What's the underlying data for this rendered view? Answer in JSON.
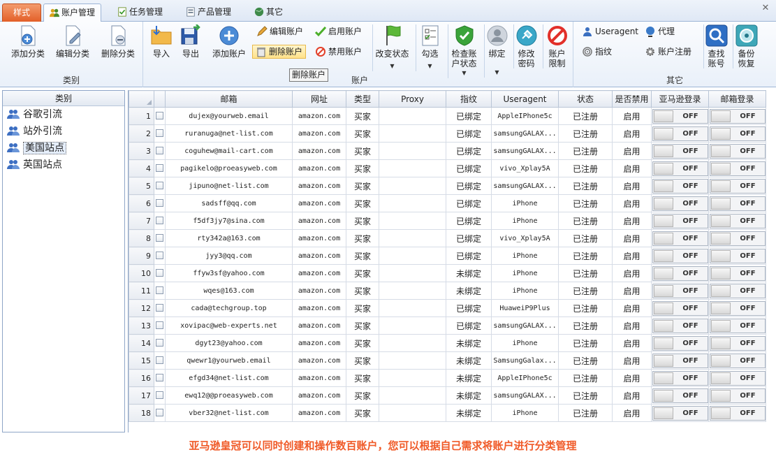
{
  "tabs": [
    {
      "label": "样式",
      "icon": ""
    },
    {
      "label": "账户管理",
      "icon": "users-icon"
    },
    {
      "label": "任务管理",
      "icon": "task-icon"
    },
    {
      "label": "产品管理",
      "icon": "product-icon"
    },
    {
      "label": "其它",
      "icon": "globe-icon"
    }
  ],
  "ribbon": {
    "category_group": {
      "title": "类别",
      "add": "添加分类",
      "edit": "编辑分类",
      "delete": "删除分类"
    },
    "account_group": {
      "title": "账户",
      "import": "导入",
      "export": "导出",
      "add_account": "添加账户",
      "edit_account": "编辑账户",
      "delete_account": "删除账户",
      "enable_account": "启用账户",
      "disable_account": "禁用账户",
      "change_status": "改变状态",
      "tick": "勾选",
      "check_status_line1": "检查账",
      "check_status_line2": "户状态",
      "bind": "绑定",
      "change_pw_line1": "修改",
      "change_pw_line2": "密码",
      "limit_line1": "账户",
      "limit_line2": "限制"
    },
    "other_group": {
      "title": "其它",
      "useragent": "Useragent",
      "proxy": "代理",
      "fingerprint": "指纹",
      "register": "账户注册",
      "find_line1": "查找",
      "find_line2": "账号",
      "backup_line1": "备份",
      "backup_line2": "恢复"
    },
    "tooltip": "删除账户"
  },
  "left_panel": {
    "header": "类别",
    "items": [
      "谷歌引流",
      "站外引流",
      "美国站点",
      "英国站点"
    ],
    "selected": "美国站点"
  },
  "grid": {
    "columns": [
      "邮箱",
      "网址",
      "类型",
      "Proxy",
      "指纹",
      "Useragent",
      "状态",
      "是否禁用",
      "亚马逊登录",
      "邮箱登录"
    ],
    "toggle_label": "OFF",
    "rows": [
      {
        "no": "1",
        "email": "dujex@yourweb.email",
        "site": "amazon.com",
        "type": "买家",
        "proxy": "",
        "fp": "已绑定",
        "ua": "AppleIPhone5c",
        "status": "已注册",
        "enabled": "启用"
      },
      {
        "no": "2",
        "email": "ruranuga@net-list.com",
        "site": "amazon.com",
        "type": "买家",
        "proxy": "",
        "fp": "已绑定",
        "ua": "samsungGALAX...",
        "status": "已注册",
        "enabled": "启用"
      },
      {
        "no": "3",
        "email": "coguhew@mail-cart.com",
        "site": "amazon.com",
        "type": "买家",
        "proxy": "",
        "fp": "已绑定",
        "ua": "samsungGALAX...",
        "status": "已注册",
        "enabled": "启用"
      },
      {
        "no": "4",
        "email": "pagikelo@proeasyweb.com",
        "site": "amazon.com",
        "type": "买家",
        "proxy": "",
        "fp": "已绑定",
        "ua": "vivo_Xplay5A",
        "status": "已注册",
        "enabled": "启用"
      },
      {
        "no": "5",
        "email": "jipuno@net-list.com",
        "site": "amazon.com",
        "type": "买家",
        "proxy": "",
        "fp": "已绑定",
        "ua": "samsungGALAX...",
        "status": "已注册",
        "enabled": "启用"
      },
      {
        "no": "6",
        "email": "sadsff@qq.com",
        "site": "amazon.com",
        "type": "买家",
        "proxy": "",
        "fp": "已绑定",
        "ua": "iPhone",
        "status": "已注册",
        "enabled": "启用"
      },
      {
        "no": "7",
        "email": "f5df3jy7@sina.com",
        "site": "amazon.com",
        "type": "买家",
        "proxy": "",
        "fp": "已绑定",
        "ua": "iPhone",
        "status": "已注册",
        "enabled": "启用"
      },
      {
        "no": "8",
        "email": "rty342a@163.com",
        "site": "amazon.com",
        "type": "买家",
        "proxy": "",
        "fp": "已绑定",
        "ua": "vivo_Xplay5A",
        "status": "已注册",
        "enabled": "启用"
      },
      {
        "no": "9",
        "email": "jyy3@qq.com",
        "site": "amazon.com",
        "type": "买家",
        "proxy": "",
        "fp": "已绑定",
        "ua": "iPhone",
        "status": "已注册",
        "enabled": "启用"
      },
      {
        "no": "10",
        "email": "ffyw3sf@yahoo.com",
        "site": "amazon.com",
        "type": "买家",
        "proxy": "",
        "fp": "未绑定",
        "ua": "iPhone",
        "status": "已注册",
        "enabled": "启用"
      },
      {
        "no": "11",
        "email": "wqes@163.com",
        "site": "amazon.com",
        "type": "买家",
        "proxy": "",
        "fp": "未绑定",
        "ua": "iPhone",
        "status": "已注册",
        "enabled": "启用"
      },
      {
        "no": "12",
        "email": "cada@techgroup.top",
        "site": "amazon.com",
        "type": "买家",
        "proxy": "",
        "fp": "已绑定",
        "ua": "HuaweiP9Plus",
        "status": "已注册",
        "enabled": "启用"
      },
      {
        "no": "13",
        "email": "xovipac@web-experts.net",
        "site": "amazon.com",
        "type": "买家",
        "proxy": "",
        "fp": "已绑定",
        "ua": "samsungGALAX...",
        "status": "已注册",
        "enabled": "启用"
      },
      {
        "no": "14",
        "email": "dgyt23@yahoo.com",
        "site": "amazon.com",
        "type": "买家",
        "proxy": "",
        "fp": "未绑定",
        "ua": "iPhone",
        "status": "已注册",
        "enabled": "启用"
      },
      {
        "no": "15",
        "email": "qwewr1@yourweb.email",
        "site": "amazon.com",
        "type": "买家",
        "proxy": "",
        "fp": "未绑定",
        "ua": "SamsungGalax...",
        "status": "已注册",
        "enabled": "启用"
      },
      {
        "no": "16",
        "email": "efgd34@net-list.com",
        "site": "amazon.com",
        "type": "买家",
        "proxy": "",
        "fp": "未绑定",
        "ua": "AppleIPhone5c",
        "status": "已注册",
        "enabled": "启用"
      },
      {
        "no": "17",
        "email": "ewq12@@proeasyweb.com",
        "site": "amazon.com",
        "type": "买家",
        "proxy": "",
        "fp": "未绑定",
        "ua": "samsungGALAX...",
        "status": "已注册",
        "enabled": "启用"
      },
      {
        "no": "18",
        "email": "vber32@net-list.com",
        "site": "amazon.com",
        "type": "买家",
        "proxy": "",
        "fp": "未绑定",
        "ua": "iPhone",
        "status": "已注册",
        "enabled": "启用"
      }
    ]
  },
  "caption": "亚马逊皇冠可以同时创建和操作数百账户，您可以根据自己需求将账户进行分类管理"
}
